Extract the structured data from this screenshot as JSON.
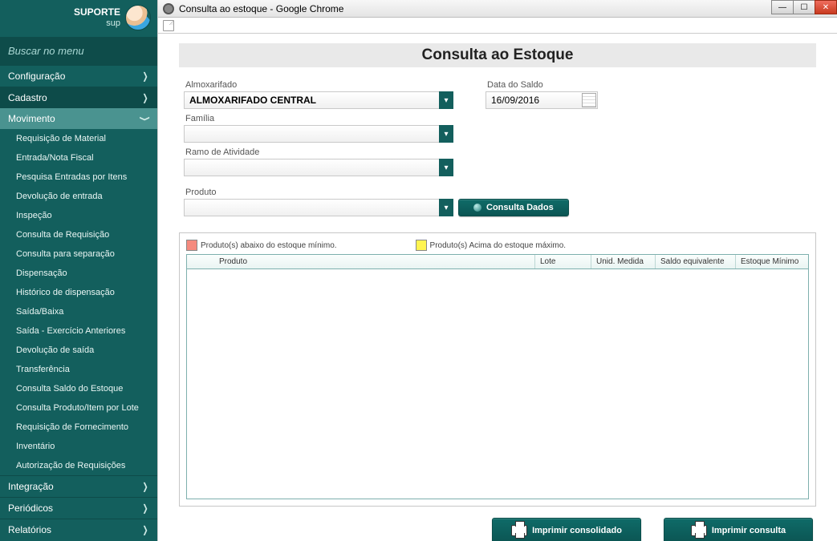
{
  "user": {
    "name": "SUPORTE",
    "role": "sup"
  },
  "search_placeholder": "Buscar no menu",
  "menu": {
    "config": "Configuração",
    "cadastro": "Cadastro",
    "movimento": "Movimento",
    "submenu": [
      "Requisição de Material",
      "Entrada/Nota Fiscal",
      "Pesquisa Entradas por Itens",
      "Devolução de entrada",
      "Inspeção",
      "Consulta de Requisição",
      "Consulta para separação",
      "Dispensação",
      "Histórico de dispensação",
      "Saída/Baixa",
      "Saída - Exercício Anteriores",
      "Devolução de saída",
      "Transferência",
      "Consulta Saldo do Estoque",
      "Consulta Produto/Item por Lote",
      "Requisição de Fornecimento",
      "Inventário",
      "Autorização de Requisições"
    ],
    "integracao": "Integração",
    "periodicos": "Periódicos",
    "relatorios": "Relatórios"
  },
  "window_title": "Consulta ao estoque - Google Chrome",
  "page_title": "Consulta ao Estoque",
  "labels": {
    "almoxarifado": "Almoxarifado",
    "data_saldo": "Data do Saldo",
    "familia": "Família",
    "ramo": "Ramo de Atividade",
    "produto": "Produto"
  },
  "values": {
    "almoxarifado": "ALMOXARIFADO CENTRAL",
    "data_saldo": "16/09/2016",
    "familia": "",
    "ramo": "",
    "produto": ""
  },
  "buttons": {
    "consulta": "Consulta Dados",
    "imprimir_consolidado": "Imprimir consolidado",
    "imprimir_consulta": "Imprimir consulta"
  },
  "legend": {
    "min": "Produto(s) abaixo do estoque mínimo.",
    "max": "Produto(s) Acima do estoque máximo."
  },
  "grid_headers": {
    "produto": "Produto",
    "lote": "Lote",
    "unid": "Unid. Medida",
    "saldo": "Saldo equivalente",
    "min": "Estoque Mínimo"
  }
}
